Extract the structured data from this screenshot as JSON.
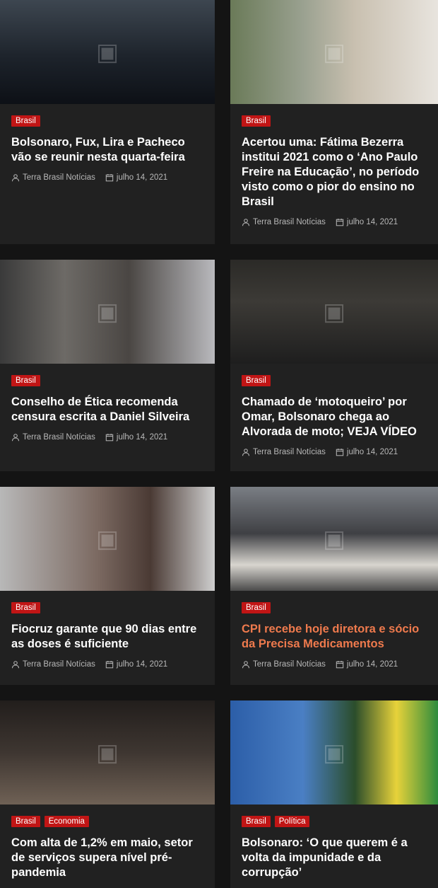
{
  "author_icon": "user-icon",
  "date_icon": "calendar-icon",
  "colors": {
    "background": "#141414",
    "card": "#212121",
    "category_badge": "#c11515",
    "hover_title": "#ef7a4d",
    "meta_text": "#b8b8b8"
  },
  "articles": [
    {
      "image": "photo-icon",
      "categories": [
        "Brasil"
      ],
      "title": "Bolsonaro, Fux, Lira e Pacheco vão se reunir nesta quarta-feira",
      "author": "Terra Brasil Notícias",
      "date": "julho 14, 2021"
    },
    {
      "image": "photo-icon",
      "categories": [
        "Brasil"
      ],
      "title": "Acertou uma: Fátima Bezerra institui 2021 como o ‘Ano Paulo Freire na Educação’, no período visto como o pior do ensino no Brasil",
      "author": "Terra Brasil Notícias",
      "date": "julho 14, 2021"
    },
    {
      "image": "photo-icon",
      "categories": [
        "Brasil"
      ],
      "title": "Conselho de Ética recomenda censura escrita a Daniel Silveira",
      "author": "Terra Brasil Notícias",
      "date": "julho 14, 2021"
    },
    {
      "image": "photo-icon",
      "categories": [
        "Brasil"
      ],
      "title": "Chamado de ‘motoqueiro’ por Omar, Bolsonaro chega ao Alvorada de moto; VEJA VÍDEO",
      "author": "Terra Brasil Notícias",
      "date": "julho 14, 2021"
    },
    {
      "image": "photo-icon",
      "categories": [
        "Brasil"
      ],
      "title": "Fiocruz garante que 90 dias entre as doses é suficiente",
      "author": "Terra Brasil Notícias",
      "date": "julho 14, 2021"
    },
    {
      "image": "photo-icon",
      "categories": [
        "Brasil"
      ],
      "title": "CPI recebe hoje diretora e sócio da Precisa Medicamentos",
      "author": "Terra Brasil Notícias",
      "date": "julho 14, 2021"
    },
    {
      "image": "photo-icon",
      "categories": [
        "Brasil",
        "Economia"
      ],
      "title": "Com alta de 1,2% em maio, setor de serviços supera nível pré-pandemia",
      "author": "",
      "date": ""
    },
    {
      "image": "photo-icon",
      "categories": [
        "Brasil",
        "Política"
      ],
      "title": "Bolsonaro: ‘O que querem é a volta da impunidade e da corrupção’",
      "author": "",
      "date": ""
    }
  ]
}
